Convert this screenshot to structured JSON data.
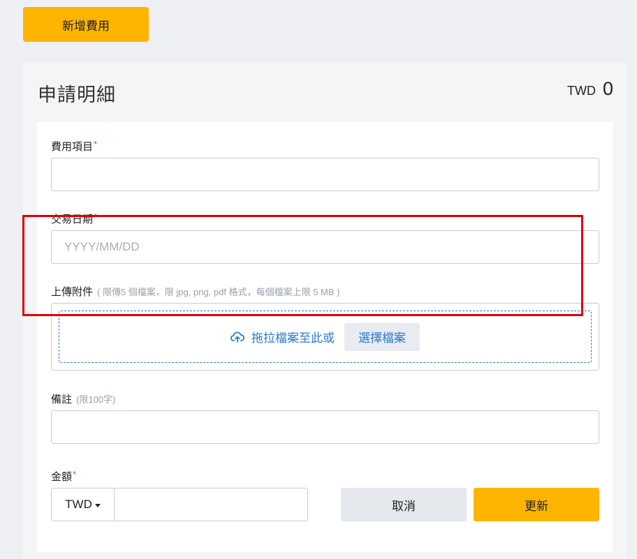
{
  "toolbar": {
    "add_expense_label": "新增費用"
  },
  "panel": {
    "title": "申請明細",
    "total_currency": "TWD",
    "total_amount": "0"
  },
  "form": {
    "expense_item": {
      "label": "費用項目",
      "required_mark": "*",
      "value": ""
    },
    "transaction_date": {
      "label": "交易日期",
      "required_mark": "*",
      "placeholder": "YYYY/MM/DD",
      "value": ""
    },
    "attachment": {
      "label": "上傳附件",
      "hint": "( 限傳5 個檔案，限 jpg, png, pdf 格式，每個檔案上限 5 MB )",
      "drag_text": "拖拉檔案至此或",
      "choose_label": "選擇檔案",
      "upload_icon": "cloud-upload-icon"
    },
    "remark": {
      "label": "備註",
      "hint": "(限100字)",
      "value": ""
    },
    "amount": {
      "label": "金額",
      "required_mark": "*",
      "currency": "TWD",
      "value": ""
    }
  },
  "actions": {
    "cancel_label": "取消",
    "update_label": "更新"
  },
  "colors": {
    "accent": "#ffb400",
    "link": "#2a7bd1",
    "required": "#e84b3c",
    "highlight_frame": "#e00000",
    "background": "#eef0f3"
  }
}
